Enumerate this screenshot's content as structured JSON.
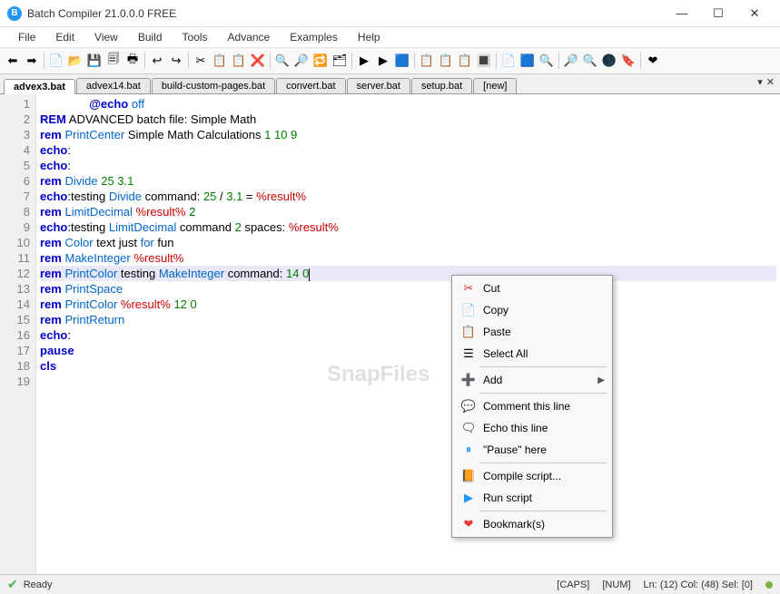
{
  "titlebar": {
    "title": "Batch Compiler 21.0.0.0 FREE"
  },
  "menubar": [
    "File",
    "Edit",
    "View",
    "Build",
    "Tools",
    "Advance",
    "Examples",
    "Help"
  ],
  "toolbar_icons": [
    "⬅",
    "➡",
    "📄",
    "📂",
    "💾",
    "🗐",
    "🖶",
    "↩",
    "↪",
    "✂",
    "📋",
    "📋",
    "❌",
    "🔍",
    "🔎",
    "🔁",
    "🗂",
    "▶",
    "▶",
    "🟦",
    "📋",
    "📋",
    "📋",
    "🔳",
    "📄",
    "🟦",
    "🔍",
    "🔎",
    "🔍",
    "🌑",
    "🔖",
    "❤"
  ],
  "tabs": [
    {
      "label": "advex3.bat",
      "active": true
    },
    {
      "label": "advex14.bat",
      "active": false
    },
    {
      "label": "build-custom-pages.bat",
      "active": false
    },
    {
      "label": "convert.bat",
      "active": false
    },
    {
      "label": "server.bat",
      "active": false
    },
    {
      "label": "setup.bat",
      "active": false
    },
    {
      "label": "[new]",
      "active": false
    }
  ],
  "code_lines": [
    {
      "n": 1,
      "html": "               <span class='kw'>@echo</span> <span class='cmd'>off</span>"
    },
    {
      "n": 2,
      "html": "<span class='kw'>REM</span> ADVANCED batch file: Simple Math"
    },
    {
      "n": 3,
      "html": "<span class='kw'>rem</span> <span class='cmd'>PrintCenter</span> Simple Math Calculations <span class='num'>1 10 9</span>"
    },
    {
      "n": 4,
      "html": "<span class='kw'>echo</span>:"
    },
    {
      "n": 5,
      "html": "<span class='kw'>echo</span>:"
    },
    {
      "n": 6,
      "html": "<span class='kw'>rem</span> <span class='cmd'>Divide</span> <span class='num'>25 3.1</span>"
    },
    {
      "n": 7,
      "html": "<span class='kw'>echo</span>:testing <span class='cmd'>Divide</span> command: <span class='num'>25</span> / <span class='num'>3.1</span> = <span class='var'>%result%</span>"
    },
    {
      "n": 8,
      "html": "<span class='kw'>rem</span> <span class='cmd'>LimitDecimal</span> <span class='var'>%result%</span> <span class='num'>2</span>"
    },
    {
      "n": 9,
      "html": "<span class='kw'>echo</span>:testing <span class='cmd'>LimitDecimal</span> command <span class='num'>2</span> spaces: <span class='var'>%result%</span>"
    },
    {
      "n": 10,
      "html": "<span class='kw'>rem</span> <span class='cmd'>Color</span> text just <span class='cmd'>for</span> fun"
    },
    {
      "n": 11,
      "html": "<span class='kw'>rem</span> <span class='cmd'>MakeInteger</span> <span class='var'>%result%</span>"
    },
    {
      "n": 12,
      "hl": true,
      "html": "<span class='kw'>rem</span> <span class='cmd'>PrintColor</span> testing <span class='cmd'>MakeInteger</span> command: <span class='num'>14 0</span><span class='caret'></span>"
    },
    {
      "n": 13,
      "html": "<span class='kw'>rem</span> <span class='cmd'>PrintSpace</span>"
    },
    {
      "n": 14,
      "html": "<span class='kw'>rem</span> <span class='cmd'>PrintColor</span> <span class='var'>%result%</span> <span class='num'>12 0</span>"
    },
    {
      "n": 15,
      "html": "<span class='kw'>rem</span> <span class='cmd'>PrintReturn</span>"
    },
    {
      "n": 16,
      "html": "<span class='kw'>echo</span>:"
    },
    {
      "n": 17,
      "html": "<span class='kw'>pause</span>"
    },
    {
      "n": 18,
      "html": "<span class='kw'>cls</span>"
    },
    {
      "n": 19,
      "html": ""
    }
  ],
  "context_menu": [
    {
      "icon": "✂",
      "label": "Cut",
      "color": "#d33"
    },
    {
      "icon": "📄",
      "label": "Copy"
    },
    {
      "icon": "📋",
      "label": "Paste"
    },
    {
      "icon": "☰",
      "label": "Select All",
      "sep_after": true
    },
    {
      "icon": "➕",
      "label": "Add",
      "submenu": true,
      "sep_after": true
    },
    {
      "icon": "💬",
      "label": "Comment this line"
    },
    {
      "icon": "🗨",
      "label": "Echo this line"
    },
    {
      "icon": "⏸",
      "label": "\"Pause\" here",
      "color": "#2196F3",
      "sep_after": true
    },
    {
      "icon": "📙",
      "label": "Compile script..."
    },
    {
      "icon": "▶",
      "label": "Run script",
      "color": "#2196F3",
      "sep_after": true
    },
    {
      "icon": "❤",
      "label": "Bookmark(s)",
      "color": "#e53935"
    }
  ],
  "statusbar": {
    "ready": "Ready",
    "caps": "[CAPS]",
    "num": "[NUM]",
    "pos": "Ln:  (12)  Col:  (48)  Sel:  [0]"
  },
  "watermark": "SnapFiles"
}
